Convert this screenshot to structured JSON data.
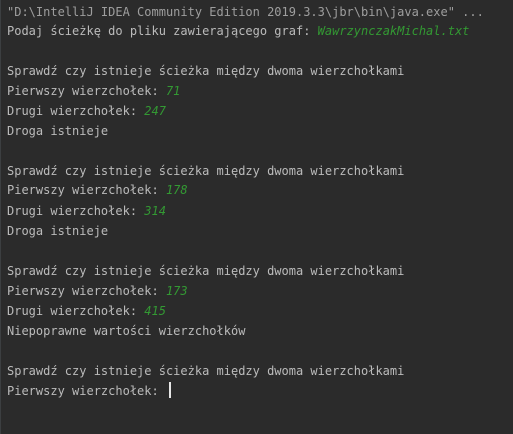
{
  "console": {
    "command_line": "\"D:\\IntelliJ IDEA Community Edition 2019.3.3\\jbr\\bin\\java.exe\" ...",
    "file_prompt": "Podaj ścieżkę do pliku zawierającego graf: ",
    "file_input": "WawrzynczakMichal.txt",
    "blocks": [
      {
        "header": "Sprawdź czy istnieje ścieżka między dwoma wierzchołkami",
        "first_prompt": "Pierwszy wierzchołek: ",
        "first_value": "71",
        "second_prompt": "Drugi wierzchołek: ",
        "second_value": "247",
        "result": "Droga istnieje"
      },
      {
        "header": "Sprawdź czy istnieje ścieżka między dwoma wierzchołkami",
        "first_prompt": "Pierwszy wierzchołek: ",
        "first_value": "178",
        "second_prompt": "Drugi wierzchołek: ",
        "second_value": "314",
        "result": "Droga istnieje"
      },
      {
        "header": "Sprawdź czy istnieje ścieżka między dwoma wierzchołkami",
        "first_prompt": "Pierwszy wierzchołek: ",
        "first_value": "173",
        "second_prompt": "Drugi wierzchołek: ",
        "second_value": "415",
        "result": "Niepoprawne wartości wierzchołków"
      },
      {
        "header": "Sprawdź czy istnieje ścieżka między dwoma wierzchołkami",
        "first_prompt": "Pierwszy wierzchołek: "
      }
    ]
  },
  "colors": {
    "background": "#2b2b2b",
    "output_text": "#bbbbbb",
    "command_text": "#9e9e9e",
    "user_input": "#339933"
  }
}
